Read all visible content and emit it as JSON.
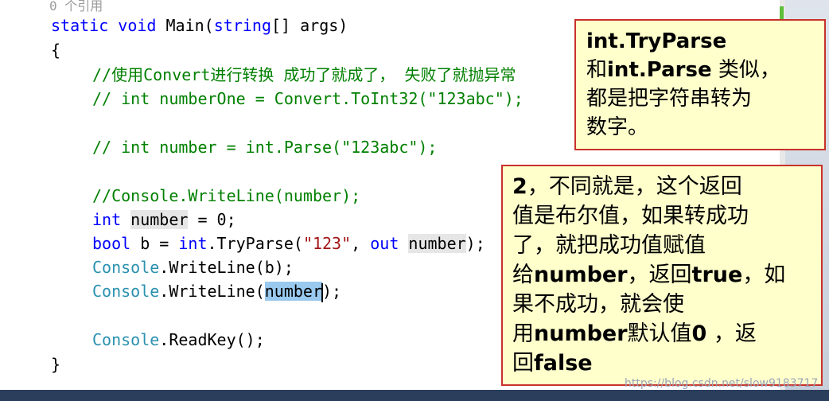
{
  "editor": {
    "reference_hint": "0 个引用",
    "method_signature": {
      "static": "static",
      "void": "void",
      "name": "Main(",
      "param_type": "string",
      "rest": "[] args)"
    },
    "open_brace": "{",
    "close_brace": "}",
    "comment_convert": "//使用Convert进行转换 成功了就成了， 失败了就抛异常",
    "comment_number_one": "// int numberOne = Convert.ToInt32(\"123abc\");",
    "comment_parse": "// int number = int.Parse(\"123abc\");",
    "comment_writeline": "//Console.WriteLine(number);",
    "decl_line": {
      "kw": "int",
      "space": " ",
      "var": "number",
      "rest": " = 0;"
    },
    "bool_line": {
      "kw_bool": "bool",
      "b_assign": " b = ",
      "kw_int": "int",
      "tryparse": ".TryParse(",
      "str": "\"123\"",
      "comma": ", ",
      "kw_out": "out",
      "space": " ",
      "var": "number",
      "rest": ");"
    },
    "writeline_b": {
      "type": "Console",
      "rest": ".WriteLine(b);"
    },
    "writeline_number": {
      "type": "Console",
      "call": ".WriteLine(",
      "var": "number",
      "rest": ");"
    },
    "readkey": {
      "type": "Console",
      "rest": ".ReadKey();"
    }
  },
  "note1": {
    "line1_b": "int.TryParse",
    "line2_pre": "和",
    "line2_b": "int.Parse",
    "line2_post": " 类似，",
    "line3": "都是把字符串转为",
    "line4": "数字。"
  },
  "note2": {
    "line1_b": "2",
    "line1_post": "，不同就是，这个返回",
    "line2": "值是布尔值，如果转成功",
    "line3": "了，就把成功值赋值",
    "line4_pre": "给",
    "line4_b1": "number",
    "line4_mid": "，返回",
    "line4_b2": "true",
    "line4_post": "，如",
    "line5": "果不成功，就会使",
    "line6_pre": "用",
    "line6_b1": "number",
    "line6_mid": "默认值",
    "line6_b2": "0",
    "line6_post": " ，返",
    "line7_pre": "回",
    "line7_b": "false"
  },
  "watermark": "https://blog.csdn.net/slow9183717",
  "colors": {
    "keyword": "#0000ff",
    "type": "#2b91af",
    "comment": "#008000",
    "string": "#a31515",
    "note_bg": "#ffffcc",
    "note_border": "#c8322b",
    "selection": "#99c9ef"
  }
}
